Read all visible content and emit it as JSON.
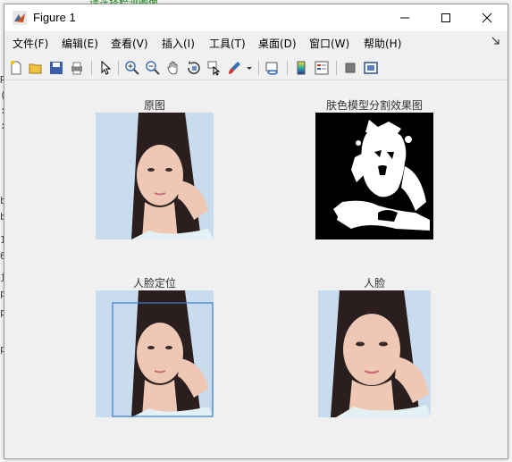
{
  "window": {
    "title": "Figure 1"
  },
  "menu": [
    "文件(F)",
    "编辑(E)",
    "查看(V)",
    "插入(I)",
    "工具(T)",
    "桌面(D)",
    "窗口(W)",
    "帮助(H)"
  ],
  "backdrop": {
    "top_text": "请选择检测图像",
    "left_chars": [
      "R",
      "(",
      ":",
      ":",
      "b",
      "b",
      "1",
      "6",
      "j",
      "p",
      "p",
      "p"
    ]
  },
  "subplots": [
    {
      "title": "原图",
      "image": "portrait-photo"
    },
    {
      "title": "肤色模型分割效果图",
      "image": "skin-segmentation-mask"
    },
    {
      "title": "人脸定位",
      "image": "portrait-photo-with-face-box"
    },
    {
      "title": "人脸",
      "image": "cropped-face-photo"
    }
  ],
  "colors": {
    "title_bar": "#ffffff",
    "figure_bg": "#f0f0f0",
    "face_box": "#3a7fd0",
    "mask_bg": "#000000",
    "mask_fg": "#ffffff"
  }
}
